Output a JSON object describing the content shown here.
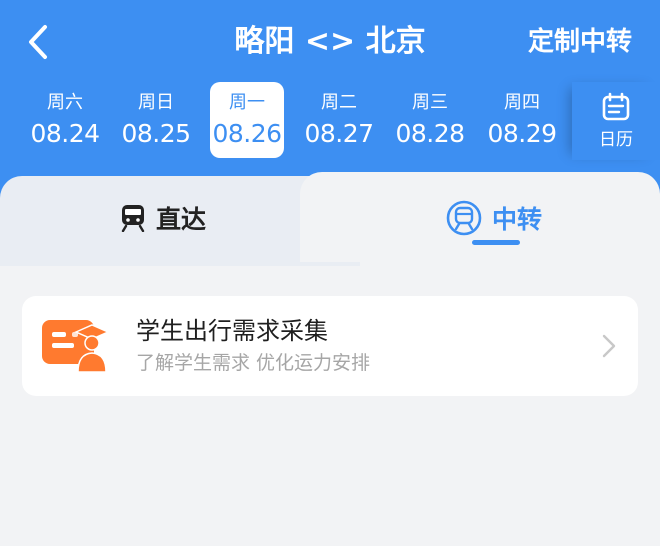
{
  "header": {
    "title": "略阳 <> 北京",
    "custom_transfer": "定制中转"
  },
  "dates": [
    {
      "dow": "周六",
      "date": "08.24",
      "selected": false
    },
    {
      "dow": "周日",
      "date": "08.25",
      "selected": false
    },
    {
      "dow": "周一",
      "date": "08.26",
      "selected": true
    },
    {
      "dow": "周二",
      "date": "08.27",
      "selected": false
    },
    {
      "dow": "周三",
      "date": "08.28",
      "selected": false
    },
    {
      "dow": "周四",
      "date": "08.29",
      "selected": false
    }
  ],
  "calendar": {
    "label": "日历",
    "icon": "calendar-icon"
  },
  "tabs": {
    "direct": {
      "label": "直达",
      "icon": "train-icon"
    },
    "transfer": {
      "label": "中转",
      "icon": "train-circle-icon",
      "active": true
    }
  },
  "card": {
    "title": "学生出行需求采集",
    "subtitle": "了解学生需求 优化运力安排",
    "icon": "student-card-icon"
  },
  "colors": {
    "brand_blue": "#3d8ff2",
    "card_orange": "#ff7a2f"
  }
}
